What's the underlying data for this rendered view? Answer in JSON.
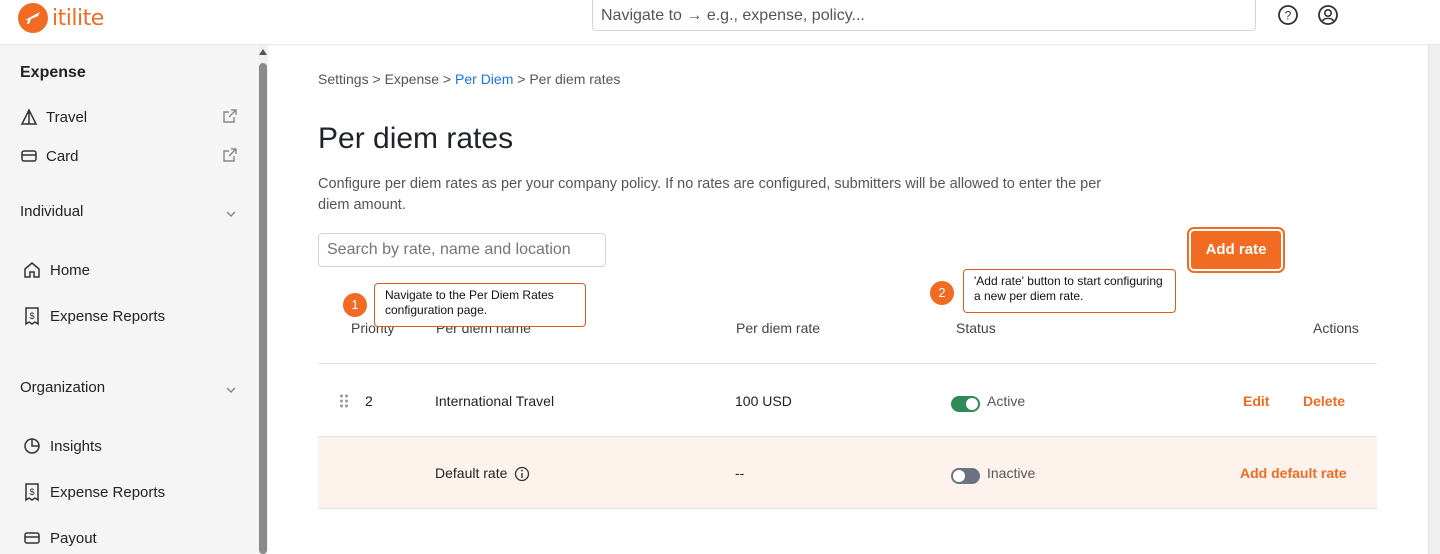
{
  "brand": {
    "name": "itilite",
    "accent": "#f26b22"
  },
  "topbar": {
    "search_placeholder": "Navigate to → e.g., expense, policy...",
    "help_icon": "help-circle-icon",
    "profile_icon": "user-circle-icon"
  },
  "sidebar": {
    "expense_heading": "Expense",
    "travel": "Travel",
    "card": "Card",
    "individual_heading": "Individual",
    "home": "Home",
    "expense_reports_1": "Expense Reports",
    "organization_heading": "Organization",
    "insights": "Insights",
    "expense_reports_2": "Expense Reports",
    "payout": "Payout"
  },
  "breadcrumb": {
    "settings": "Settings",
    "expense": "Expense",
    "per_diem": "Per Diem",
    "current": "Per diem rates",
    "sep": " > "
  },
  "page": {
    "title": "Per diem rates",
    "description": "Configure per diem rates as per your company policy. If no rates are configured, submitters will be allowed to enter the per diem amount.",
    "search_placeholder": "Search by rate, name and location",
    "add_button": "Add rate"
  },
  "table": {
    "headers": {
      "priority": "Priority",
      "name": "Per diem name",
      "rate": "Per diem rate",
      "status": "Status",
      "actions": "Actions"
    },
    "rows": [
      {
        "priority": "2",
        "name": "International Travel",
        "rate": "100 USD",
        "status": "Active",
        "active": true,
        "edit": "Edit",
        "delete": "Delete"
      },
      {
        "priority": "",
        "name": "Default rate",
        "rate": "--",
        "status": "Inactive",
        "active": false,
        "action": "Add default rate"
      }
    ]
  },
  "annotations": [
    {
      "step": "1",
      "text": "Navigate to the Per Diem Rates configuration page."
    },
    {
      "step": "2",
      "text": "'Add rate' button to start configuring a new per diem rate."
    }
  ],
  "colors": {
    "active_toggle": "#2e8b57",
    "inactive_toggle": "#6b7280",
    "link": "#1a73e8"
  }
}
